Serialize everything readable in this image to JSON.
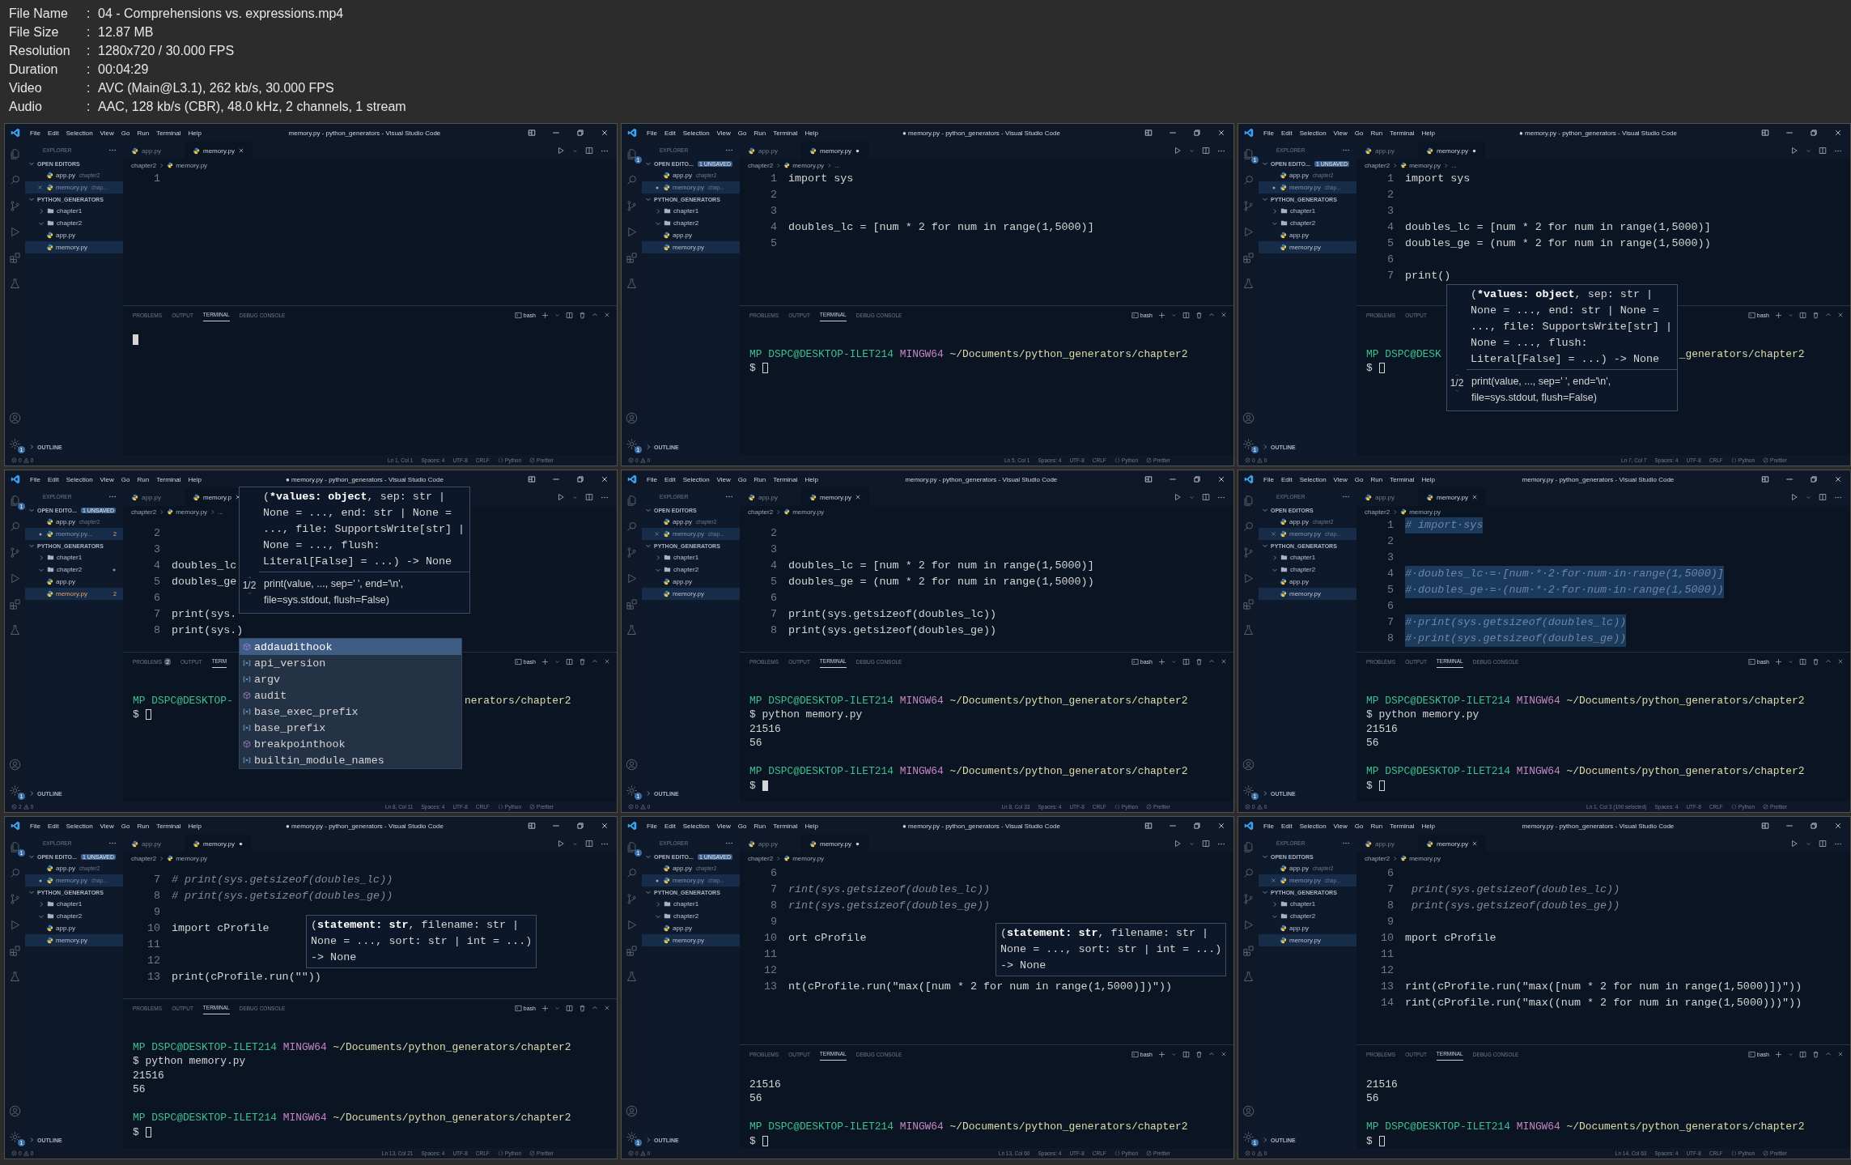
{
  "header": [
    {
      "label": "File Name",
      "sep": ":",
      "value": "04 - Comprehensions vs. expressions.mp4"
    },
    {
      "label": "File Size",
      "sep": ":",
      "value": "12.87 MB"
    },
    {
      "label": "Resolution",
      "sep": ":",
      "value": "1280x720 / 30.000 FPS"
    },
    {
      "label": "Duration",
      "sep": ":",
      "value": "00:04:29"
    },
    {
      "label": "Video",
      "sep": ":",
      "value": "AVC (Main@L3.1), 262 kb/s, 30.000 FPS"
    },
    {
      "label": "Audio",
      "sep": ":",
      "value": "AAC, 128 kb/s (CBR), 48.0 kHz, 2 channels, 1 stream"
    }
  ],
  "frames": [
    {
      "title": "memory.py - python_generators - Visual Studio Code",
      "menu": [
        "File",
        "Edit",
        "Selection",
        "View",
        "Go",
        "Run",
        "Terminal",
        "Help"
      ],
      "settings_badge": "1",
      "sidebar": {
        "heading": "EXPLORER",
        "open_editors": "OPEN EDITORS",
        "open_items": [
          {
            "name": "app.py",
            "detail": "chapter2",
            "kind": "plain",
            "selected": false
          },
          {
            "name": "memory.py",
            "detail": "chap...",
            "kind": "closable",
            "selected": true
          }
        ],
        "project": "PYTHON_GENERATORS",
        "tree": [
          {
            "name": "chapter1",
            "kind": "folder",
            "expanded": false
          },
          {
            "name": "chapter2",
            "kind": "folder",
            "expanded": true,
            "children": [
              {
                "name": "app.py",
                "kind": "file",
                "selected": false
              },
              {
                "name": "memory.py",
                "kind": "file",
                "selected": true
              }
            ]
          }
        ],
        "outline": "OUTLINE"
      },
      "tabs": [
        {
          "label": "app.py",
          "selected": false,
          "dirty": false
        },
        {
          "label": "memory.py",
          "selected": true,
          "dirty": false
        }
      ],
      "breadcrumb": [
        "chapter2",
        "memory.py"
      ],
      "code": [
        {
          "n": "1",
          "kind": "code"
        }
      ],
      "panel": {
        "tabs": [
          {
            "label": "PROBLEMS",
            "selected": false
          },
          {
            "label": "OUTPUT",
            "selected": false
          },
          {
            "label": "TERMINAL",
            "selected": true
          },
          {
            "label": "DEBUG CONSOLE",
            "selected": false
          }
        ],
        "shell": "bash",
        "lines": [
          {
            "kind": "cursor-block"
          }
        ]
      },
      "status": {
        "errors": "0",
        "warnings": "0",
        "items": [
          {
            "text": "Ln 1, Col 1",
            "kind": "plain"
          },
          {
            "text": "Spaces: 4",
            "kind": "plain"
          },
          {
            "text": "UTF-8",
            "kind": "plain"
          },
          {
            "text": "CRLF",
            "kind": "plain"
          },
          {
            "text": "Python",
            "kind": "language"
          },
          {
            "text": "Prettier",
            "kind": "formatter"
          }
        ]
      }
    },
    {
      "title": "● memory.py - python_generators - Visual Studio Code",
      "menu": [
        "File",
        "Edit",
        "Selection",
        "View",
        "Go",
        "Run",
        "Terminal",
        "Help"
      ],
      "explorer_badge": "1",
      "settings_badge": "1",
      "sidebar": {
        "heading": "EXPLORER",
        "open_editors": "OPEN EDITO...",
        "unsaved": "1 UNSAVED",
        "open_items": [
          {
            "name": "app.py",
            "detail": "chapter2",
            "kind": "plain",
            "selected": false
          },
          {
            "name": "memory.py",
            "detail": "chap...",
            "kind": "dirty",
            "selected": true
          }
        ],
        "project": "PYTHON_GENERATORS",
        "tree": [
          {
            "name": "chapter1",
            "kind": "folder",
            "expanded": false
          },
          {
            "name": "chapter2",
            "kind": "folder",
            "expanded": true,
            "children": [
              {
                "name": "app.py",
                "kind": "file",
                "selected": false
              },
              {
                "name": "memory.py",
                "kind": "file",
                "selected": true
              }
            ]
          }
        ],
        "outline": "OUTLINE"
      },
      "tabs": [
        {
          "label": "app.py",
          "selected": false,
          "dirty": false
        },
        {
          "label": "memory.py",
          "selected": true,
          "dirty": true
        }
      ],
      "breadcrumb": [
        "chapter2",
        "memory.py",
        "..."
      ],
      "code": [
        {
          "n": "1",
          "text": "import sys",
          "kind": "code"
        },
        {
          "n": "2",
          "kind": "code"
        },
        {
          "n": "3",
          "kind": "code"
        },
        {
          "n": "4",
          "text": "doubles_lc = [num * 2 for num in range(1,5000)]",
          "kind": "code"
        },
        {
          "n": "5",
          "kind": "code"
        }
      ],
      "panel": {
        "tabs": [
          {
            "label": "PROBLEMS",
            "selected": false
          },
          {
            "label": "OUTPUT",
            "selected": false
          },
          {
            "label": "TERMINAL",
            "selected": true
          },
          {
            "label": "DEBUG CONSOLE",
            "selected": false
          }
        ],
        "shell": "bash",
        "lines": [
          {
            "kind": "blank"
          },
          {
            "kind": "prompt",
            "user": "MP DSPC@DESKTOP-ILET214",
            "shell": "MINGW64",
            "path": "~/Documents/python_generators/chapter2"
          },
          {
            "kind": "cursor-hollow",
            "prompt": "$"
          }
        ]
      },
      "status": {
        "errors": "0",
        "warnings": "0",
        "items": [
          {
            "text": "Ln 5, Col 1",
            "kind": "plain"
          },
          {
            "text": "Spaces: 4",
            "kind": "plain"
          },
          {
            "text": "UTF-8",
            "kind": "plain"
          },
          {
            "text": "CRLF",
            "kind": "plain"
          },
          {
            "text": "Python",
            "kind": "language"
          },
          {
            "text": "Prettier",
            "kind": "formatter"
          }
        ]
      }
    },
    {
      "title": "● memory.py - python_generators - Visual Studio Code",
      "menu": [
        "File",
        "Edit",
        "Selection",
        "View",
        "Go",
        "Run",
        "Terminal",
        "Help"
      ],
      "explorer_badge": "1",
      "settings_badge": "1",
      "sidebar": {
        "heading": "EXPLORER",
        "open_editors": "OPEN EDITO...",
        "unsaved": "1 UNSAVED",
        "open_items": [
          {
            "name": "app.py",
            "detail": "chapter2",
            "kind": "plain",
            "selected": false
          },
          {
            "name": "memory.py",
            "detail": "chap...",
            "kind": "dirty",
            "selected": true
          }
        ],
        "project": "PYTHON_GENERATORS",
        "tree": [
          {
            "name": "chapter1",
            "kind": "folder",
            "expanded": false
          },
          {
            "name": "chapter2",
            "kind": "folder",
            "expanded": true,
            "children": [
              {
                "name": "app.py",
                "kind": "file",
                "selected": false
              },
              {
                "name": "memory.py",
                "kind": "file",
                "selected": true
              }
            ]
          }
        ],
        "outline": "OUTLINE"
      },
      "tabs": [
        {
          "label": "app.py",
          "selected": false,
          "dirty": false
        },
        {
          "label": "memory.py",
          "selected": true,
          "dirty": true
        }
      ],
      "breadcrumb": [
        "chapter2",
        "memory.py",
        "..."
      ],
      "code": [
        {
          "n": "1",
          "text": "import sys",
          "kind": "code"
        },
        {
          "n": "2",
          "kind": "code"
        },
        {
          "n": "3",
          "kind": "code"
        },
        {
          "n": "4",
          "text": "doubles_lc = [num * 2 for num in range(1,5000)]",
          "kind": "code"
        },
        {
          "n": "5",
          "text": "doubles_ge = (num * 2 for num in range(1,5000))",
          "kind": "code"
        },
        {
          "n": "6",
          "kind": "code"
        },
        {
          "n": "7",
          "text": "print()",
          "kind": "code"
        }
      ],
      "popups": [
        {
          "kind": "signature",
          "open": "(",
          "active": "*values: object",
          "rest": ", sep: str | None = ..., end: str | None = ..., file: SupportsWrite[str] | None = ..., flush: Literal[False] = ...) -> None",
          "doc": "print(value, ..., sep=' ', end='\\n', file=sys.stdout, flush=False)",
          "overload": "1/2"
        }
      ],
      "panel": {
        "tabs": [
          {
            "label": "PROBLEMS",
            "selected": false
          },
          {
            "label": "OUTPUT",
            "selected": false
          }
        ],
        "shell": "bash",
        "lines": [
          {
            "kind": "blank"
          },
          {
            "kind": "prompt-split",
            "left": "MP DSPC@DESK",
            "right": "_generators/chapter2"
          },
          {
            "kind": "cursor-hollow",
            "prompt": "$"
          }
        ]
      },
      "status": {
        "errors": "0",
        "warnings": "0",
        "items": [
          {
            "text": "Ln 7, Col 7",
            "kind": "plain"
          },
          {
            "text": "Spaces: 4",
            "kind": "plain"
          },
          {
            "text": "UTF-8",
            "kind": "plain"
          },
          {
            "text": "CRLF",
            "kind": "plain"
          },
          {
            "text": "Python",
            "kind": "language"
          },
          {
            "text": "Prettier",
            "kind": "formatter"
          }
        ]
      }
    },
    {
      "title": "● memory.py - python_generators - Visual Studio Code",
      "menu": [
        "File",
        "Edit",
        "Selection",
        "View",
        "Go",
        "Run",
        "Terminal",
        "Help"
      ],
      "explorer_badge": "1",
      "settings_badge": "1",
      "sidebar": {
        "heading": "EXPLORER",
        "open_editors": "OPEN EDITO...",
        "unsaved": "1 UNSAVED",
        "open_items": [
          {
            "name": "app.py",
            "detail": "chapter2",
            "kind": "plain",
            "selected": false
          },
          {
            "name": "memory.py...",
            "problems": "2",
            "kind": "dirty",
            "selected": true
          }
        ],
        "project": "PYTHON_GENERATORS",
        "tree": [
          {
            "name": "chapter1",
            "kind": "folder",
            "expanded": false,
            "modified": false
          },
          {
            "name": "chapter2",
            "kind": "folder",
            "expanded": true,
            "modified": true,
            "children": [
              {
                "name": "app.py",
                "kind": "file",
                "selected": false
              },
              {
                "name": "memory.py",
                "kind": "file",
                "selected": true,
                "problems": "2"
              }
            ]
          }
        ],
        "outline": "OUTLINE"
      },
      "tabs": [
        {
          "label": "app.py",
          "selected": false,
          "dirty": false
        },
        {
          "label": "memory.p",
          "selected": true,
          "dirty": false
        }
      ],
      "breadcrumb": [
        "chapter2",
        "memory.py",
        "..."
      ],
      "code": [
        {
          "n": "2",
          "kind": "code"
        },
        {
          "n": "3",
          "kind": "code"
        },
        {
          "n": "4",
          "text": "doubles_lc",
          "kind": "code"
        },
        {
          "n": "5",
          "text": "doubles_ge",
          "kind": "code"
        },
        {
          "n": "6",
          "kind": "code"
        },
        {
          "n": "7",
          "text": "print(sys.",
          "kind": "code"
        },
        {
          "n": "8",
          "text": "print(sys.)",
          "kind": "code"
        }
      ],
      "popups": [
        {
          "kind": "signature",
          "open": "(",
          "active": "*values: object",
          "rest": ", sep: str | None = ..., end: str | None = ..., file: SupportsWrite[str] | None = ..., flush: Literal[False] = ...) -> None",
          "doc": "print(value, ..., sep=' ', end='\\n', file=sys.stdout, flush=False)",
          "overload": "1/2"
        },
        {
          "kind": "completion",
          "items": [
            {
              "label": "addaudithook",
              "kind": "method",
              "selected": true
            },
            {
              "label": "api_version",
              "kind": "variable",
              "selected": false
            },
            {
              "label": "argv",
              "kind": "variable",
              "selected": false
            },
            {
              "label": "audit",
              "kind": "method",
              "selected": false
            },
            {
              "label": "base_exec_prefix",
              "kind": "variable",
              "selected": false
            },
            {
              "label": "base_prefix",
              "kind": "variable",
              "selected": false
            },
            {
              "label": "breakpointhook",
              "kind": "method",
              "selected": false
            },
            {
              "label": "builtin_module_names",
              "kind": "variable",
              "selected": false
            }
          ]
        }
      ],
      "panel": {
        "tabs": [
          {
            "label": "PROBLEMS",
            "selected": false,
            "badge": "2"
          },
          {
            "label": "OUTPUT",
            "selected": false
          },
          {
            "label": "TERM",
            "selected": true
          }
        ],
        "shell": "bash",
        "lines": [
          {
            "kind": "blank"
          },
          {
            "kind": "prompt-split",
            "left": "MP DSPC@DESKTOP-",
            "right": "nerators/chapter2"
          },
          {
            "kind": "cursor-hollow",
            "prompt": "$"
          }
        ]
      },
      "status": {
        "errors": "2",
        "warnings": "0",
        "items": [
          {
            "text": "Ln 8, Col 11",
            "kind": "plain"
          },
          {
            "text": "Spaces: 4",
            "kind": "plain"
          },
          {
            "text": "UTF-8",
            "kind": "plain"
          },
          {
            "text": "CRLF",
            "kind": "plain"
          },
          {
            "text": "Python",
            "kind": "language"
          },
          {
            "text": "Prettier",
            "kind": "formatter"
          }
        ]
      }
    },
    {
      "title": "memory.py - python_generators - Visual Studio Code",
      "menu": [
        "File",
        "Edit",
        "Selection",
        "View",
        "Go",
        "Run",
        "Terminal",
        "Help"
      ],
      "settings_badge": "1",
      "sidebar": {
        "heading": "EXPLORER",
        "open_editors": "OPEN EDITORS",
        "open_items": [
          {
            "name": "app.py",
            "detail": "chapter2",
            "kind": "plain",
            "selected": false
          },
          {
            "name": "memory.py",
            "detail": "chap...",
            "kind": "closable",
            "selected": true
          }
        ],
        "project": "PYTHON_GENERATORS",
        "tree": [
          {
            "name": "chapter1",
            "kind": "folder",
            "expanded": false
          },
          {
            "name": "chapter2",
            "kind": "folder",
            "expanded": true,
            "children": [
              {
                "name": "app.py",
                "kind": "file",
                "selected": false
              },
              {
                "name": "memory.py",
                "kind": "file",
                "selected": true
              }
            ]
          }
        ],
        "outline": "OUTLINE"
      },
      "tabs": [
        {
          "label": "app.py",
          "selected": false,
          "dirty": false
        },
        {
          "label": "memory.py",
          "selected": true,
          "dirty": false
        }
      ],
      "breadcrumb": [
        "chapter2",
        "memory.py"
      ],
      "code": [
        {
          "n": "2",
          "kind": "code"
        },
        {
          "n": "3",
          "kind": "code"
        },
        {
          "n": "4",
          "text": "doubles_lc = [num * 2 for num in range(1,5000)]",
          "kind": "code"
        },
        {
          "n": "5",
          "text": "doubles_ge = (num * 2 for num in range(1,5000))",
          "kind": "code"
        },
        {
          "n": "6",
          "kind": "code"
        },
        {
          "n": "7",
          "text": "print(sys.getsizeof(doubles_lc))",
          "kind": "code"
        },
        {
          "n": "8",
          "text": "print(sys.getsizeof(doubles_ge))",
          "kind": "code"
        }
      ],
      "panel": {
        "tabs": [
          {
            "label": "PROBLEMS",
            "selected": false
          },
          {
            "label": "OUTPUT",
            "selected": false
          },
          {
            "label": "TERMINAL",
            "selected": true
          },
          {
            "label": "DEBUG CONSOLE",
            "selected": false
          }
        ],
        "shell": "bash",
        "lines": [
          {
            "kind": "blank"
          },
          {
            "kind": "prompt",
            "user": "MP DSPC@DESKTOP-ILET214",
            "shell": "MINGW64",
            "path": "~/Documents/python_generators/chapter2"
          },
          {
            "kind": "command",
            "prompt": "$",
            "text": "python memory.py"
          },
          {
            "kind": "output",
            "text": "21516"
          },
          {
            "kind": "output",
            "text": "56"
          },
          {
            "kind": "blank"
          },
          {
            "kind": "prompt",
            "user": "MP DSPC@DESKTOP-ILET214",
            "shell": "MINGW64",
            "path": "~/Documents/python_generators/chapter2"
          },
          {
            "kind": "cursor-block",
            "prompt": "$"
          }
        ]
      },
      "status": {
        "errors": "0",
        "warnings": "0",
        "items": [
          {
            "text": "Ln 8, Col 33",
            "kind": "plain"
          },
          {
            "text": "Spaces: 4",
            "kind": "plain"
          },
          {
            "text": "UTF-8",
            "kind": "plain"
          },
          {
            "text": "CRLF",
            "kind": "plain"
          },
          {
            "text": "Python",
            "kind": "language"
          },
          {
            "text": "Prettier",
            "kind": "formatter"
          }
        ]
      }
    },
    {
      "title": "memory.py - python_generators - Visual Studio Code",
      "menu": [
        "File",
        "Edit",
        "Selection",
        "View",
        "Go",
        "Run",
        "Terminal",
        "Help"
      ],
      "settings_badge": "1",
      "sidebar": {
        "heading": "EXPLORER",
        "open_editors": "OPEN EDITORS",
        "open_items": [
          {
            "name": "app.py",
            "detail": "chapter2",
            "kind": "plain",
            "selected": false
          },
          {
            "name": "memory.py",
            "detail": "chap...",
            "kind": "closable",
            "selected": true
          }
        ],
        "project": "PYTHON_GENERATORS",
        "tree": [
          {
            "name": "chapter1",
            "kind": "folder",
            "expanded": false
          },
          {
            "name": "chapter2",
            "kind": "folder",
            "expanded": true,
            "children": [
              {
                "name": "app.py",
                "kind": "file",
                "selected": false
              },
              {
                "name": "memory.py",
                "kind": "file",
                "selected": true
              }
            ]
          }
        ],
        "outline": "OUTLINE"
      },
      "tabs": [
        {
          "label": "app.py",
          "selected": false,
          "dirty": false
        },
        {
          "label": "memory.py",
          "selected": true,
          "dirty": false
        }
      ],
      "breadcrumb": [
        "chapter2",
        "memory.py"
      ],
      "code": [
        {
          "n": "1",
          "text": "# import·sys",
          "kind": "selected"
        },
        {
          "n": "2",
          "kind": "selected"
        },
        {
          "n": "3",
          "kind": "selected"
        },
        {
          "n": "4",
          "text": "#·doubles_lc·=·[num·*·2·for·num·in·range(1,5000)]",
          "kind": "selected"
        },
        {
          "n": "5",
          "text": "#·doubles_ge·=·(num·*·2·for·num·in·range(1,5000))",
          "kind": "selected"
        },
        {
          "n": "6",
          "kind": "selected"
        },
        {
          "n": "7",
          "text": "#·print(sys.getsizeof(doubles_lc))",
          "kind": "selected"
        },
        {
          "n": "8",
          "text": "#·print(sys.getsizeof(doubles_ge))",
          "kind": "selected"
        }
      ],
      "panel": {
        "tabs": [
          {
            "label": "PROBLEMS",
            "selected": false
          },
          {
            "label": "OUTPUT",
            "selected": false
          },
          {
            "label": "TERMINAL",
            "selected": true
          },
          {
            "label": "DEBUG CONSOLE",
            "selected": false
          }
        ],
        "shell": "bash",
        "lines": [
          {
            "kind": "blank"
          },
          {
            "kind": "prompt",
            "user": "MP DSPC@DESKTOP-ILET214",
            "shell": "MINGW64",
            "path": "~/Documents/python_generators/chapter2"
          },
          {
            "kind": "command",
            "prompt": "$",
            "text": "python memory.py"
          },
          {
            "kind": "output",
            "text": "21516"
          },
          {
            "kind": "output",
            "text": "56"
          },
          {
            "kind": "blank"
          },
          {
            "kind": "prompt",
            "user": "MP DSPC@DESKTOP-ILET214",
            "shell": "MINGW64",
            "path": "~/Documents/python_generators/chapter2"
          },
          {
            "kind": "cursor-hollow",
            "prompt": "$"
          }
        ]
      },
      "status": {
        "errors": "0",
        "warnings": "0",
        "items": [
          {
            "text": "Ln 1, Col 3 (190 selected)",
            "kind": "plain"
          },
          {
            "text": "Spaces: 4",
            "kind": "plain"
          },
          {
            "text": "UTF-8",
            "kind": "plain"
          },
          {
            "text": "CRLF",
            "kind": "plain"
          },
          {
            "text": "Python",
            "kind": "language"
          },
          {
            "text": "Prettier",
            "kind": "formatter"
          }
        ]
      }
    },
    {
      "title": "● memory.py - python_generators - Visual Studio Code",
      "menu": [
        "File",
        "Edit",
        "Selection",
        "View",
        "Go",
        "Run",
        "Terminal",
        "Help"
      ],
      "explorer_badge": "1",
      "settings_badge": "1",
      "sidebar": {
        "heading": "EXPLORER",
        "open_editors": "OPEN EDITO...",
        "unsaved": "1 UNSAVED",
        "open_items": [
          {
            "name": "app.py",
            "detail": "chapter2",
            "kind": "plain",
            "selected": false
          },
          {
            "name": "memory.py",
            "detail": "chap...",
            "kind": "dirty",
            "selected": true
          }
        ],
        "project": "PYTHON_GENERATORS",
        "tree": [
          {
            "name": "chapter1",
            "kind": "folder",
            "expanded": false
          },
          {
            "name": "chapter2",
            "kind": "folder",
            "expanded": true,
            "children": [
              {
                "name": "app.py",
                "kind": "file",
                "selected": false
              },
              {
                "name": "memory.py",
                "kind": "file",
                "selected": true
              }
            ]
          }
        ],
        "outline": "OUTLINE"
      },
      "tabs": [
        {
          "label": "app.py",
          "selected": false,
          "dirty": false
        },
        {
          "label": "memory.py",
          "selected": true,
          "dirty": true
        }
      ],
      "breadcrumb": [
        "chapter2",
        "memory.py"
      ],
      "code": [
        {
          "n": "7",
          "text": "# print(sys.getsizeof(doubles_lc))",
          "kind": "comment"
        },
        {
          "n": "8",
          "text": "# print(sys.getsizeof(doubles_ge))",
          "kind": "comment"
        },
        {
          "n": "9",
          "kind": "code"
        },
        {
          "n": "10",
          "text": "import cProfile",
          "kind": "code"
        },
        {
          "n": "11",
          "kind": "code"
        },
        {
          "n": "12",
          "kind": "code"
        },
        {
          "n": "13",
          "text": "print(cProfile.run(\"\"))",
          "kind": "code"
        }
      ],
      "popups": [
        {
          "kind": "signature",
          "open": "(",
          "active": "statement: str",
          "rest": ", filename: str | None = ..., sort: str | int = ...) -> None"
        }
      ],
      "panel": {
        "tabs": [
          {
            "label": "PROBLEMS",
            "selected": false
          },
          {
            "label": "OUTPUT",
            "selected": false
          },
          {
            "label": "TERMINAL",
            "selected": true
          },
          {
            "label": "DEBUG CONSOLE",
            "selected": false
          }
        ],
        "shell": "bash",
        "lines": [
          {
            "kind": "blank"
          },
          {
            "kind": "prompt",
            "user": "MP DSPC@DESKTOP-ILET214",
            "shell": "MINGW64",
            "path": "~/Documents/python_generators/chapter2"
          },
          {
            "kind": "command",
            "prompt": "$",
            "text": "python memory.py"
          },
          {
            "kind": "output",
            "text": "21516"
          },
          {
            "kind": "output",
            "text": "56"
          },
          {
            "kind": "blank"
          },
          {
            "kind": "prompt",
            "user": "MP DSPC@DESKTOP-ILET214",
            "shell": "MINGW64",
            "path": "~/Documents/python_generators/chapter2"
          },
          {
            "kind": "cursor-hollow",
            "prompt": "$"
          }
        ]
      },
      "status": {
        "errors": "0",
        "warnings": "0",
        "items": [
          {
            "text": "Ln 13, Col 21",
            "kind": "plain"
          },
          {
            "text": "Spaces: 4",
            "kind": "plain"
          },
          {
            "text": "UTF-8",
            "kind": "plain"
          },
          {
            "text": "CRLF",
            "kind": "plain"
          },
          {
            "text": "Python",
            "kind": "language"
          },
          {
            "text": "Prettier",
            "kind": "formatter"
          }
        ]
      }
    },
    {
      "title": "● memory.py - python_generators - Visual Studio Code",
      "menu": [
        "File",
        "Edit",
        "Selection",
        "View",
        "Go",
        "Run",
        "Terminal",
        "Help"
      ],
      "explorer_badge": "1",
      "settings_badge": "1",
      "sidebar": {
        "heading": "EXPLORER",
        "open_editors": "OPEN EDITO...",
        "unsaved": "1 UNSAVED",
        "open_items": [
          {
            "name": "app.py",
            "detail": "chapter2",
            "kind": "plain",
            "selected": false
          },
          {
            "name": "memory.py",
            "detail": "chap...",
            "kind": "dirty",
            "selected": true
          }
        ],
        "project": "PYTHON_GENERATORS",
        "tree": [
          {
            "name": "chapter1",
            "kind": "folder",
            "expanded": false
          },
          {
            "name": "chapter2",
            "kind": "folder",
            "expanded": true,
            "children": [
              {
                "name": "app.py",
                "kind": "file",
                "selected": false
              },
              {
                "name": "memory.py",
                "kind": "file",
                "selected": true
              }
            ]
          }
        ],
        "outline": "OUTLINE"
      },
      "tabs": [
        {
          "label": "app.py",
          "selected": false,
          "dirty": false
        },
        {
          "label": "memory.py",
          "selected": true,
          "dirty": true
        }
      ],
      "breadcrumb": [
        "chapter2",
        "memory.py"
      ],
      "code": [
        {
          "n": "6",
          "kind": "code"
        },
        {
          "n": "7",
          "text": "rint(sys.getsizeof(doubles_lc))",
          "kind": "comment"
        },
        {
          "n": "8",
          "text": "rint(sys.getsizeof(doubles_ge))",
          "kind": "comment"
        },
        {
          "n": "9",
          "kind": "code"
        },
        {
          "n": "10",
          "text": "ort cProfile",
          "kind": "code"
        },
        {
          "n": "11",
          "kind": "code"
        },
        {
          "n": "12",
          "kind": "code"
        },
        {
          "n": "13",
          "text": "nt(cProfile.run(\"max([num * 2 for num in range(1,5000)])\"))",
          "kind": "code"
        }
      ],
      "popups": [
        {
          "kind": "signature",
          "open": "(",
          "active": "statement: str",
          "rest": ", filename: str | None = ..., sort: str | int = ...) -> None"
        }
      ],
      "panel": {
        "tabs": [
          {
            "label": "PROBLEMS",
            "selected": false
          },
          {
            "label": "OUTPUT",
            "selected": false
          },
          {
            "label": "TERMINAL",
            "selected": true
          },
          {
            "label": "DEBUG CONSOLE",
            "selected": false
          }
        ],
        "shell": "bash",
        "lines": [
          {
            "kind": "blank"
          },
          {
            "kind": "output",
            "text": "21516"
          },
          {
            "kind": "output",
            "text": "56"
          },
          {
            "kind": "blank"
          },
          {
            "kind": "prompt",
            "user": "MP DSPC@DESKTOP-ILET214",
            "shell": "MINGW64",
            "path": "~/Documents/python_generators/chapter2"
          },
          {
            "kind": "cursor-hollow",
            "prompt": "$"
          }
        ]
      },
      "status": {
        "errors": "0",
        "warnings": "0",
        "items": [
          {
            "text": "Ln 13, Col 60",
            "kind": "plain"
          },
          {
            "text": "Spaces: 4",
            "kind": "plain"
          },
          {
            "text": "UTF-8",
            "kind": "plain"
          },
          {
            "text": "CRLF",
            "kind": "plain"
          },
          {
            "text": "Python",
            "kind": "language"
          },
          {
            "text": "Prettier",
            "kind": "formatter"
          }
        ]
      }
    },
    {
      "title": "memory.py - python_generators - Visual Studio Code",
      "menu": [
        "File",
        "Edit",
        "Selection",
        "View",
        "Go",
        "Run",
        "Terminal",
        "Help"
      ],
      "settings_badge": "1",
      "sidebar": {
        "heading": "EXPLORER",
        "open_editors": "OPEN EDITORS",
        "open_items": [
          {
            "name": "app.py",
            "detail": "chapter2",
            "kind": "plain",
            "selected": false
          },
          {
            "name": "memory.py",
            "detail": "chap...",
            "kind": "closable",
            "selected": true
          }
        ],
        "project": "PYTHON_GENERATORS",
        "tree": [
          {
            "name": "chapter1",
            "kind": "folder",
            "expanded": false
          },
          {
            "name": "chapter2",
            "kind": "folder",
            "expanded": true,
            "children": [
              {
                "name": "app.py",
                "kind": "file",
                "selected": false
              },
              {
                "name": "memory.py",
                "kind": "file",
                "selected": true
              }
            ]
          }
        ],
        "outline": "OUTLINE"
      },
      "tabs": [
        {
          "label": "app.py",
          "selected": false,
          "dirty": false
        },
        {
          "label": "memory.py",
          "selected": true,
          "dirty": false
        }
      ],
      "breadcrumb": [
        "chapter2",
        "memory.py"
      ],
      "code": [
        {
          "n": "6",
          "kind": "code"
        },
        {
          "n": "7",
          "text": " print(sys.getsizeof(doubles_lc))",
          "kind": "comment"
        },
        {
          "n": "8",
          "text": " print(sys.getsizeof(doubles_ge))",
          "kind": "comment"
        },
        {
          "n": "9",
          "kind": "code"
        },
        {
          "n": "10",
          "text": "mport cProfile",
          "kind": "code"
        },
        {
          "n": "11",
          "kind": "code"
        },
        {
          "n": "12",
          "kind": "code"
        },
        {
          "n": "13",
          "text": "rint(cProfile.run(\"max([num * 2 for num in range(1,5000)])\"))",
          "kind": "code"
        },
        {
          "n": "14",
          "text": "rint(cProfile.run(\"max((num * 2 for num in range(1,5000)))\"))",
          "kind": "code"
        }
      ],
      "panel": {
        "tabs": [
          {
            "label": "PROBLEMS",
            "selected": false
          },
          {
            "label": "OUTPUT",
            "selected": false
          },
          {
            "label": "TERMINAL",
            "selected": true
          },
          {
            "label": "DEBUG CONSOLE",
            "selected": false
          }
        ],
        "shell": "bash",
        "lines": [
          {
            "kind": "blank"
          },
          {
            "kind": "output",
            "text": "21516"
          },
          {
            "kind": "output",
            "text": "56"
          },
          {
            "kind": "blank"
          },
          {
            "kind": "prompt",
            "user": "MP DSPC@DESKTOP-ILET214",
            "shell": "MINGW64",
            "path": "~/Documents/python_generators/chapter2"
          },
          {
            "kind": "cursor-hollow",
            "prompt": "$"
          }
        ]
      },
      "status": {
        "errors": "0",
        "warnings": "0",
        "items": [
          {
            "text": "Ln 14, Col 63",
            "kind": "plain"
          },
          {
            "text": "Spaces: 4",
            "kind": "plain"
          },
          {
            "text": "UTF-8",
            "kind": "plain"
          },
          {
            "text": "CRLF",
            "kind": "plain"
          },
          {
            "text": "Python",
            "kind": "language"
          },
          {
            "text": "Prettier",
            "kind": "formatter"
          }
        ]
      }
    }
  ]
}
